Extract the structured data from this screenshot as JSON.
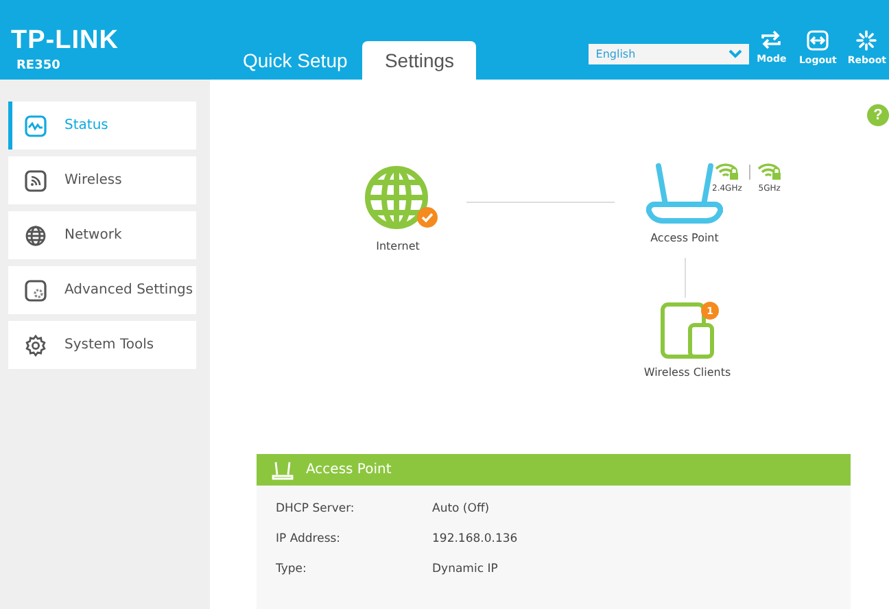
{
  "brand": {
    "logo": "TP-LINK",
    "model": "RE350"
  },
  "tabs": [
    {
      "label": "Quick Setup",
      "selected": false
    },
    {
      "label": "Settings",
      "selected": true
    }
  ],
  "language": {
    "value": "English"
  },
  "toolbar": [
    {
      "label": "Mode",
      "kind": "mode"
    },
    {
      "label": "Logout",
      "kind": "logout"
    },
    {
      "label": "Reboot",
      "kind": "reboot"
    }
  ],
  "help": "?",
  "sidebar": {
    "items": [
      {
        "label": "Status",
        "kind": "status",
        "selected": true
      },
      {
        "label": "Wireless",
        "kind": "wireless",
        "selected": false
      },
      {
        "label": "Network",
        "kind": "network",
        "selected": false
      },
      {
        "label": "Advanced Settings",
        "kind": "advanced",
        "selected": false
      },
      {
        "label": "System Tools",
        "kind": "tools",
        "selected": false
      }
    ]
  },
  "diagram": {
    "internet": {
      "label": "Internet",
      "connected": true
    },
    "access_point": {
      "label": "Access Point",
      "bands": [
        "2.4GHz",
        "5GHz"
      ]
    },
    "clients": {
      "label": "Wireless Clients",
      "count": "1"
    }
  },
  "panel": {
    "title": "Access Point",
    "rows": [
      {
        "label": "DHCP Server:",
        "value": "Auto (Off)"
      },
      {
        "label": "IP Address:",
        "value": "192.168.0.136"
      },
      {
        "label": "Type:",
        "value": "Dynamic IP"
      }
    ]
  }
}
